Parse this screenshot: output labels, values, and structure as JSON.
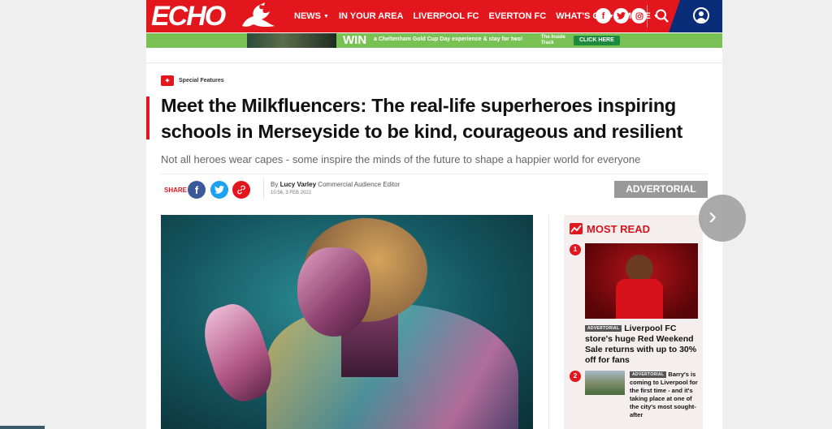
{
  "header": {
    "logo_text": "ECHO",
    "nav": [
      {
        "label": "NEWS",
        "dropdown": true
      },
      {
        "label": "IN YOUR AREA",
        "dropdown": false
      },
      {
        "label": "LIVERPOOL FC",
        "dropdown": false
      },
      {
        "label": "EVERTON FC",
        "dropdown": false
      },
      {
        "label": "WHAT'S ON",
        "dropdown": true
      },
      {
        "label": "MORE",
        "dropdown": true
      }
    ],
    "social": [
      "facebook-icon",
      "twitter-icon",
      "instagram-icon"
    ],
    "colors": {
      "brand": "#e3151d",
      "account_bg": "#0a2d7a"
    }
  },
  "promo": {
    "win": "WIN",
    "text": "a Cheltenham Gold Cup Day experience & stay for two!",
    "brand": "The Inside Track",
    "cta": "CLICK HERE",
    "bg": "#79c154"
  },
  "article": {
    "section": "Special Features",
    "headline": "Meet the Milkfluencers: The real-life superheroes inspiring schools in Merseyside to be kind, courageous and resilient",
    "standfirst": "Not all heroes wear capes - some inspire the minds of the future to shape a happier world for everyone",
    "share_label": "SHARE",
    "byline_prefix": "By",
    "author": "Lucy Varley",
    "author_role": "Commercial Audience Editor",
    "date": "10:56, 3 FEB 2022",
    "label": "ADVERTORIAL"
  },
  "most_read": {
    "title": "MOST READ",
    "items": [
      {
        "num": "1",
        "tag": "ADVERTORIAL",
        "text": "Liverpool FC store's huge Red Weekend Sale returns with up to 30% off for fans"
      },
      {
        "num": "2",
        "tag": "ADVERTORIAL",
        "text": "Barry's is coming to Liverpool for the first time - and it's taking place at one of the city's most sought-after"
      }
    ]
  }
}
